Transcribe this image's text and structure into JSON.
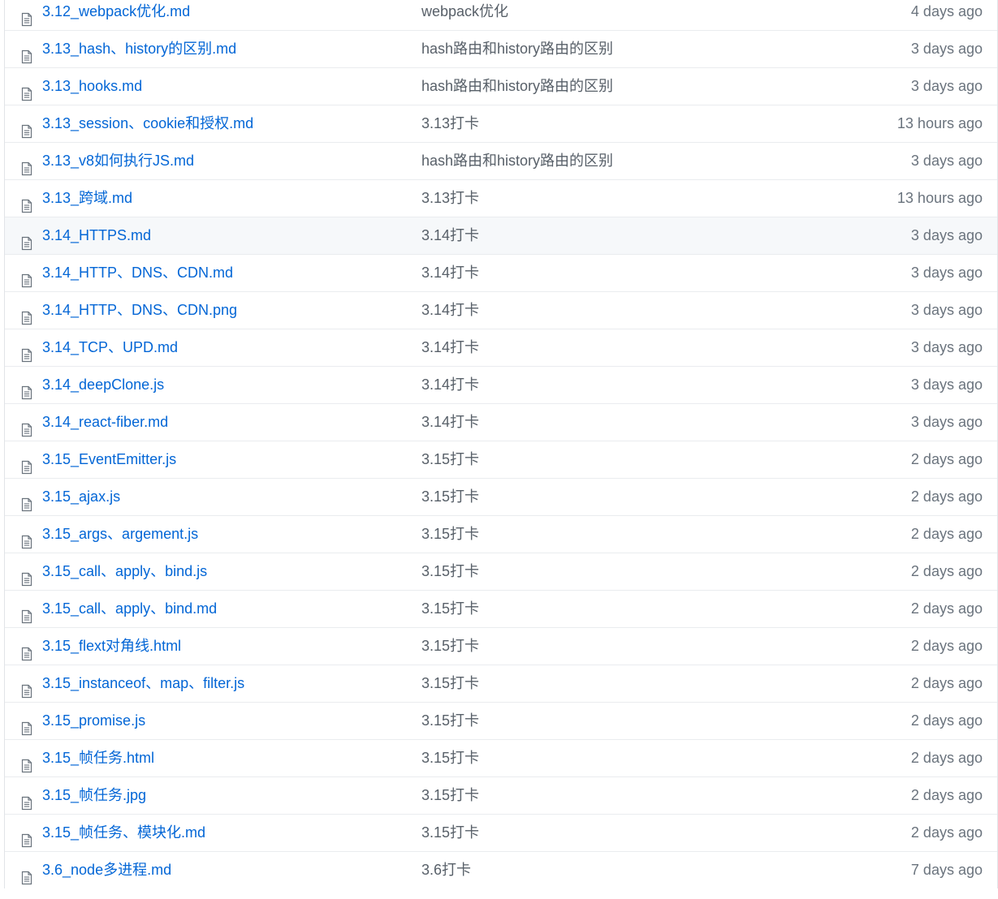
{
  "files": [
    {
      "name": "3.12_webpack优化.md",
      "message": "webpack优化",
      "age": "4 days ago"
    },
    {
      "name": "3.13_hash、history的区别.md",
      "message": "hash路由和history路由的区别",
      "age": "3 days ago"
    },
    {
      "name": "3.13_hooks.md",
      "message": "hash路由和history路由的区别",
      "age": "3 days ago"
    },
    {
      "name": "3.13_session、cookie和授权.md",
      "message": "3.13打卡",
      "age": "13 hours ago"
    },
    {
      "name": "3.13_v8如何执行JS.md",
      "message": "hash路由和history路由的区别",
      "age": "3 days ago"
    },
    {
      "name": "3.13_跨域.md",
      "message": "3.13打卡",
      "age": "13 hours ago"
    },
    {
      "name": "3.14_HTTPS.md",
      "message": "3.14打卡",
      "age": "3 days ago",
      "highlighted": true
    },
    {
      "name": "3.14_HTTP、DNS、CDN.md",
      "message": "3.14打卡",
      "age": "3 days ago"
    },
    {
      "name": "3.14_HTTP、DNS、CDN.png",
      "message": "3.14打卡",
      "age": "3 days ago"
    },
    {
      "name": "3.14_TCP、UPD.md",
      "message": "3.14打卡",
      "age": "3 days ago"
    },
    {
      "name": "3.14_deepClone.js",
      "message": "3.14打卡",
      "age": "3 days ago"
    },
    {
      "name": "3.14_react-fiber.md",
      "message": "3.14打卡",
      "age": "3 days ago"
    },
    {
      "name": "3.15_EventEmitter.js",
      "message": "3.15打卡",
      "age": "2 days ago"
    },
    {
      "name": "3.15_ajax.js",
      "message": "3.15打卡",
      "age": "2 days ago"
    },
    {
      "name": "3.15_args、argement.js",
      "message": "3.15打卡",
      "age": "2 days ago"
    },
    {
      "name": "3.15_call、apply、bind.js",
      "message": "3.15打卡",
      "age": "2 days ago"
    },
    {
      "name": "3.15_call、apply、bind.md",
      "message": "3.15打卡",
      "age": "2 days ago"
    },
    {
      "name": "3.15_flext对角线.html",
      "message": "3.15打卡",
      "age": "2 days ago"
    },
    {
      "name": "3.15_instanceof、map、filter.js",
      "message": "3.15打卡",
      "age": "2 days ago"
    },
    {
      "name": "3.15_promise.js",
      "message": "3.15打卡",
      "age": "2 days ago"
    },
    {
      "name": "3.15_帧任务.html",
      "message": "3.15打卡",
      "age": "2 days ago"
    },
    {
      "name": "3.15_帧任务.jpg",
      "message": "3.15打卡",
      "age": "2 days ago"
    },
    {
      "name": "3.15_帧任务、模块化.md",
      "message": "3.15打卡",
      "age": "2 days ago"
    },
    {
      "name": "3.6_node多进程.md",
      "message": "3.6打卡",
      "age": "7 days ago"
    }
  ],
  "icon": "file-text-icon",
  "colors": {
    "link": "#0366d6",
    "message": "#586069",
    "age": "#6a737d",
    "icon": "#6a737d",
    "row_border": "#eaecef",
    "highlight_bg": "#f6f8fa"
  }
}
